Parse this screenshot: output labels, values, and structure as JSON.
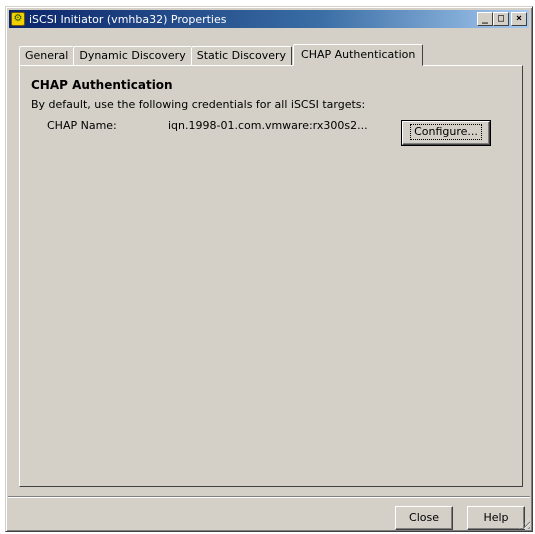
{
  "window": {
    "title": "iSCSI Initiator (vmhba32) Properties",
    "controls": {
      "minimize": "_",
      "maximize": "□",
      "close": "×"
    }
  },
  "tabs": [
    {
      "label": "General",
      "active": false
    },
    {
      "label": "Dynamic Discovery",
      "active": false
    },
    {
      "label": "Static Discovery",
      "active": false
    },
    {
      "label": "CHAP Authentication",
      "active": true
    }
  ],
  "chap": {
    "section_title": "CHAP Authentication",
    "description": "By default, use the following credentials for all iSCSI targets:",
    "name_label": "CHAP Name:",
    "name_value": "iqn.1998-01.com.vmware:rx300s2...",
    "configure_label": "Configure..."
  },
  "footer": {
    "close_label": "Close",
    "help_label": "Help"
  },
  "icons": {
    "app": "iscsi-app-icon",
    "grip": "resize-grip-icon"
  },
  "colors": {
    "titlebar_start": "#0a246a",
    "titlebar_end": "#a6caf0",
    "face": "#d4d0c8"
  }
}
